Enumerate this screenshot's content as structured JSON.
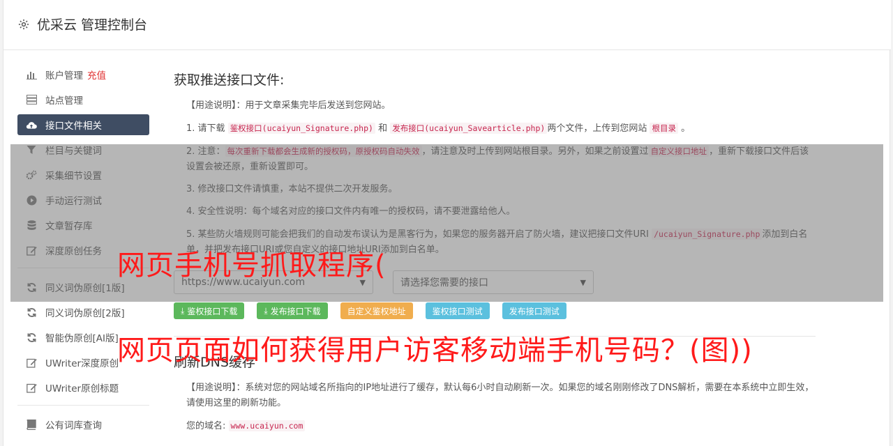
{
  "app": {
    "title": "优采云 管理控制台"
  },
  "sidebar": {
    "group1": [
      {
        "label": "账户管理",
        "extra": "充值",
        "icon": "bar-chart-icon"
      },
      {
        "label": "站点管理",
        "icon": "server-icon"
      },
      {
        "label": "接口文件相关",
        "icon": "cloud-upload-icon",
        "active": true
      },
      {
        "label": "栏目与关键词",
        "icon": "filter-icon"
      },
      {
        "label": "采集细节设置",
        "icon": "cogs-icon"
      },
      {
        "label": "手动运行测试",
        "icon": "play-circle-icon"
      },
      {
        "label": "文章暂存库",
        "icon": "database-icon"
      },
      {
        "label": "深度原创任务",
        "icon": "edit-icon"
      }
    ],
    "group2": [
      {
        "label": "同义词伪原创[1版]",
        "icon": "refresh-icon"
      },
      {
        "label": "同义词伪原创[2版]",
        "icon": "refresh-icon"
      },
      {
        "label": "智能伪原创[AI版]",
        "icon": "refresh-icon"
      },
      {
        "label": "UWriter深度原创",
        "icon": "edit-icon"
      },
      {
        "label": "UWriter原创标题",
        "icon": "edit-icon"
      }
    ],
    "group3": [
      {
        "label": "公有词库查询",
        "icon": "book-icon"
      }
    ]
  },
  "section1": {
    "title": "获取推送接口文件:",
    "usage": "【用途说明】：用于文章采集完毕后发送到您网站。",
    "step1": {
      "a": "1. 请下载",
      "code1": "鉴权接口(ucaiyun_Signature.php)",
      "b": "和",
      "code2": "发布接口(ucaiyun_Savearticle.php)",
      "c": "两个文件，上传到您网站",
      "code3": "根目录",
      "d": "。"
    },
    "step2": {
      "a": "2. 注意：",
      "code1": "每次重新下载都会生成新的授权码，原授权码自动失效",
      "b": "，请注意及时上传到网站根目录。另外，如果之前设置过",
      "code2": "自定义接口地址",
      "c": "，重新下载接口文件后该设置会被还原，重新设置即可。"
    },
    "step3": "3. 修改接口文件请慎重，本站不提供二次开发服务。",
    "step4": "4. 安全性说明：每个域名对应的接口文件内有唯一的授权码，请不要泄露给他人。",
    "step5": {
      "a": "5. 某些防火墙规则可能会把我们的自动发布误认为是黑客行为，如果您的服务器开启了防火墙，建议把接口文件URI",
      "code1": "/ucaiyun_Signature.php",
      "b": "添加到白名单，并把发布接口URI或您自定义的接口地址URI添加到白名单。"
    },
    "site_select": "https://www.ucaiyun.com",
    "interface_select": "请选择您需要的接口",
    "buttons": {
      "download_auth": "鉴权接口下载",
      "download_publish": "发布接口下载",
      "custom_auth": "自定义鉴权地址",
      "test_auth": "鉴权接口测试",
      "test_publish": "发布接口测试"
    }
  },
  "section2": {
    "title": "刷新DNS缓存",
    "usage": "【用途说明】：系统对您的网站域名所指向的IP地址进行了缓存，默认每6小时自动刷新一次。如果您的域名刚刚修改了DNS解析，需要在本系统中立即生效，请使用这里的刷新功能。",
    "domain_label": "您的域名:",
    "domain_value": "www.ucaiyun.com"
  },
  "watermark": {
    "line1": "网页手机号抓取程序(",
    "line2": "网页页面如何获得用户访客移动端手机号码？(图))"
  },
  "colors": {
    "active_nav": "#3f4d63",
    "green": "#5cb85c",
    "orange": "#f0ad4e",
    "blue": "#5bc0de",
    "watermark": "#ff1a1a",
    "code": "#c7254e"
  }
}
